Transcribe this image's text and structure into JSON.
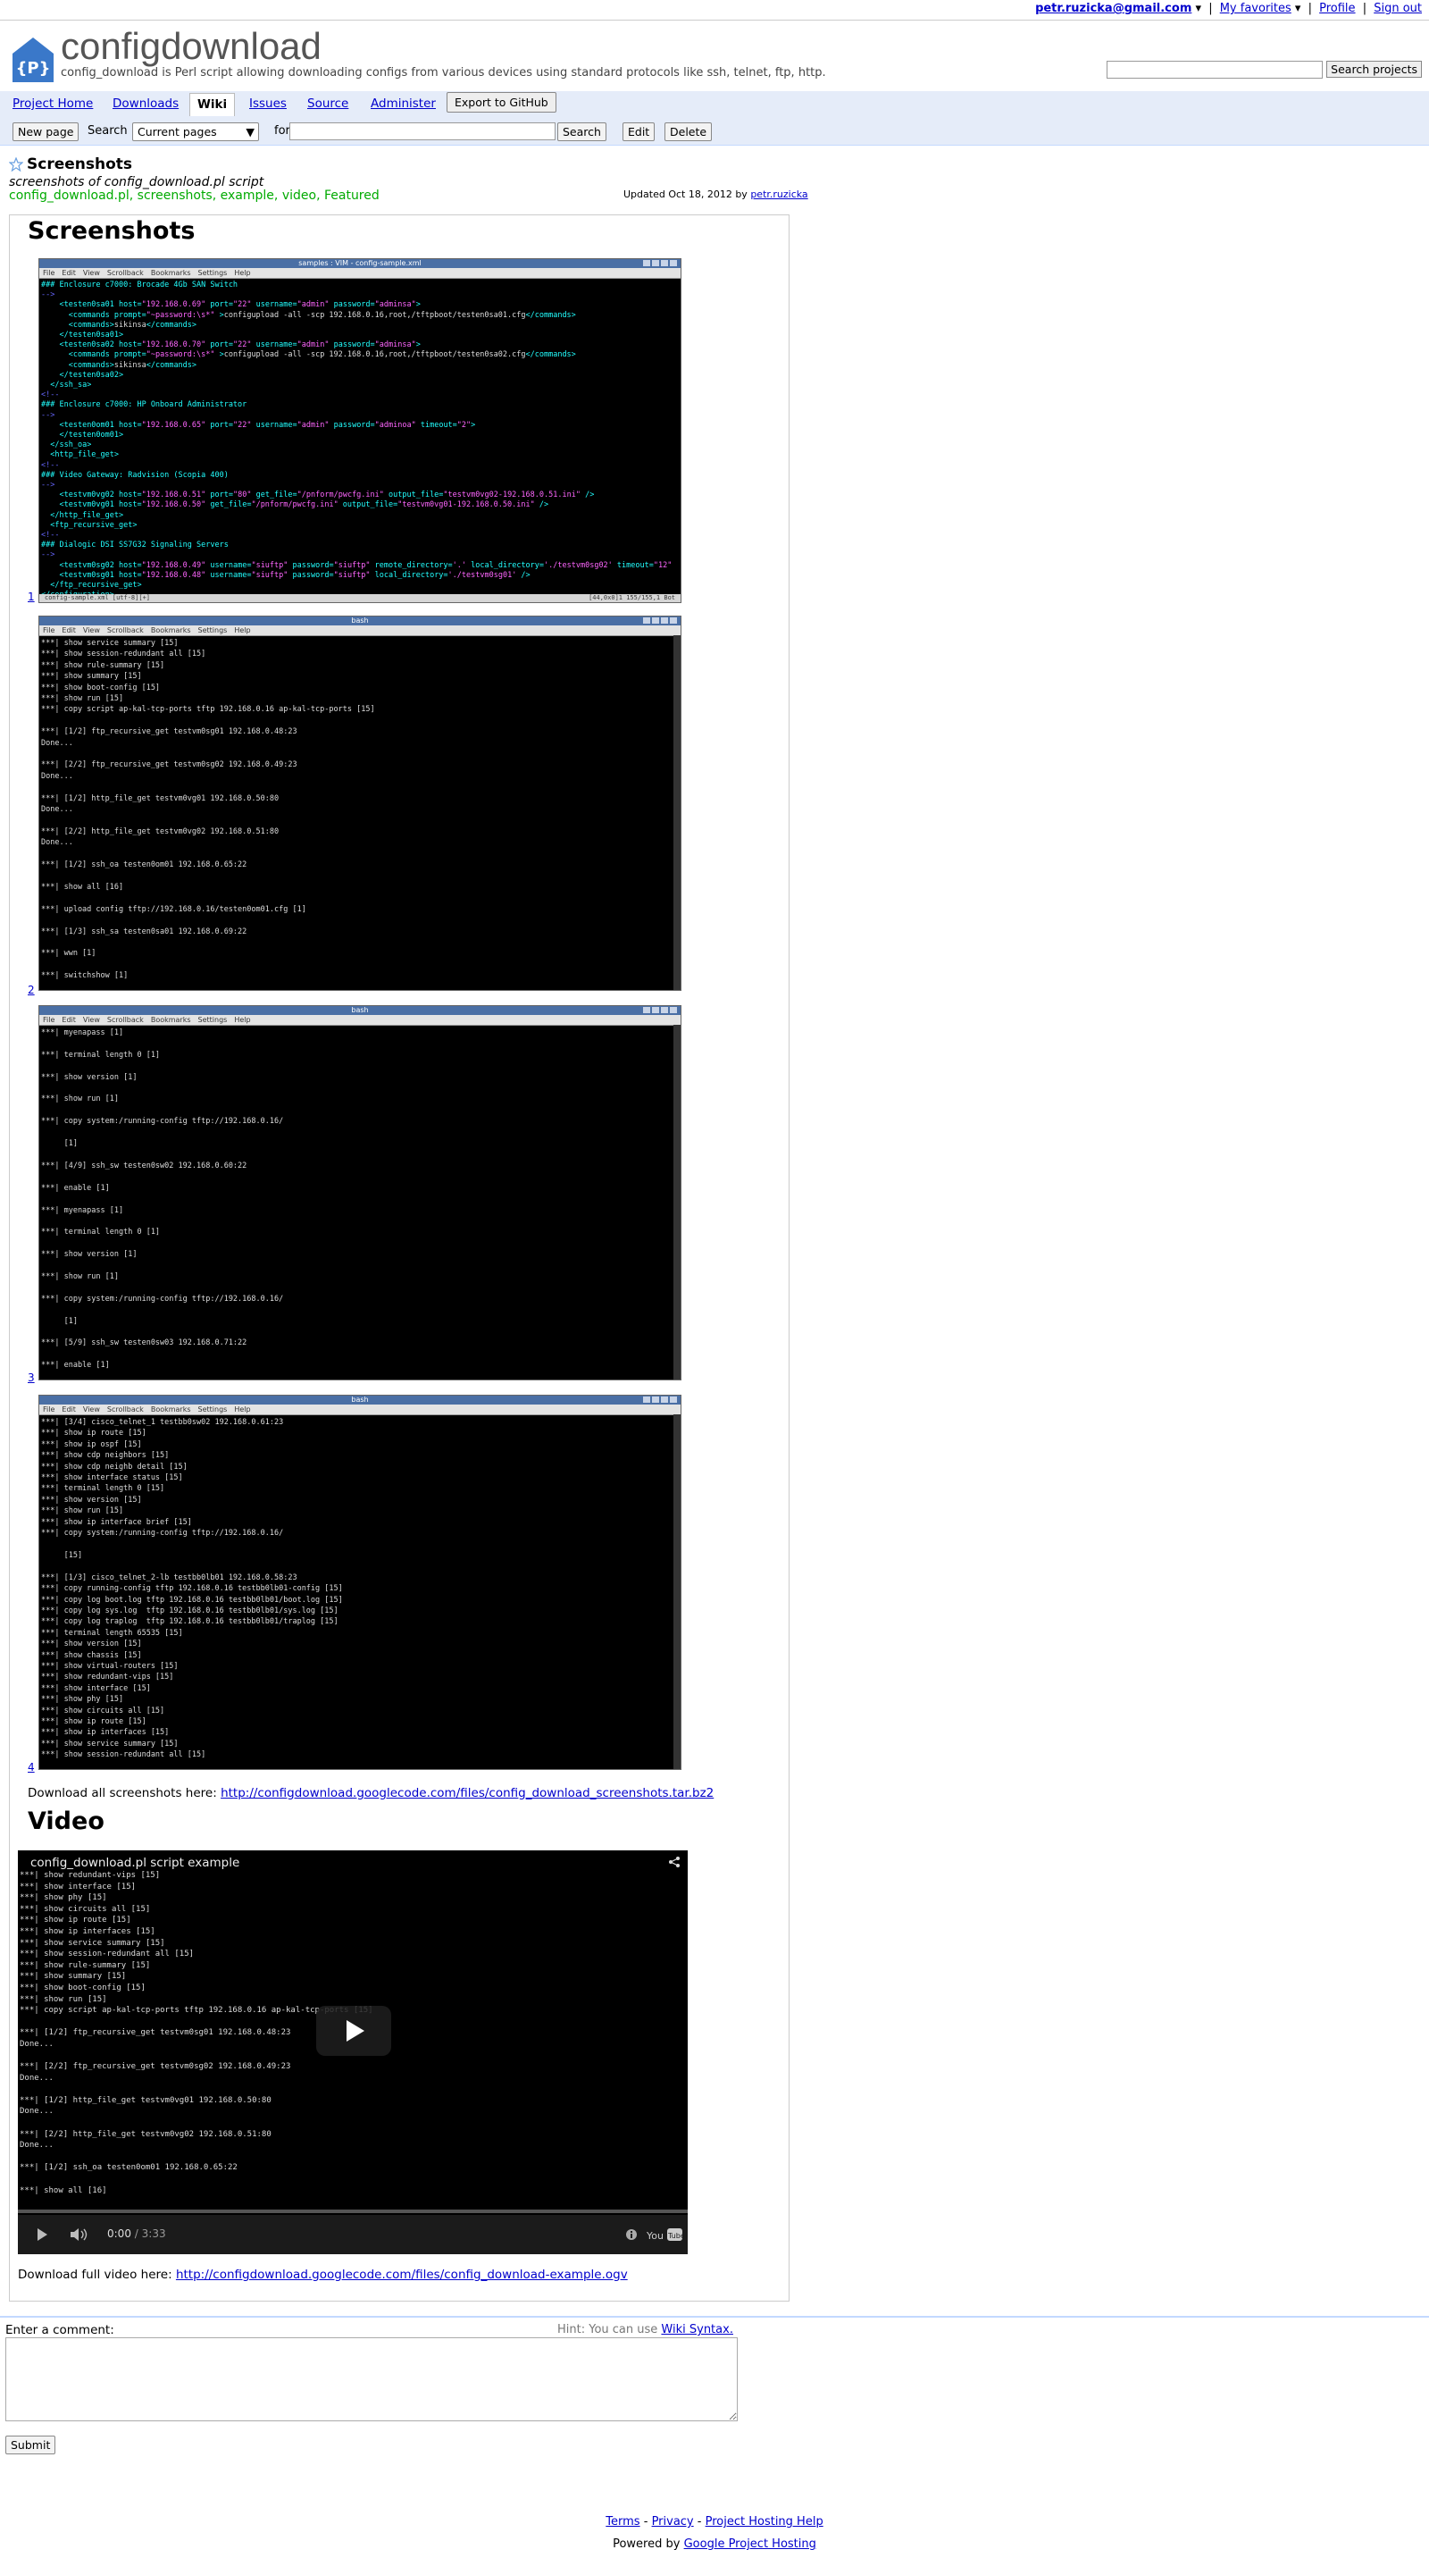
{
  "topbar": {
    "email": "petr.ruzicka@gmail.com",
    "favorites": "My favorites",
    "profile": "Profile",
    "signout": "Sign out"
  },
  "header": {
    "title": "configdownload",
    "summary": "config_download is Perl script allowing downloading configs from various devices using standard protocols like ssh, telnet, ftp, http.",
    "search_button": "Search projects"
  },
  "tabs": [
    "Project Home",
    "Downloads",
    "Wiki",
    "Issues",
    "Source",
    "Administer"
  ],
  "export_button": "Export to GitHub",
  "wiki_bar": {
    "new_page": "New page",
    "search_label": "Search",
    "scope": "Current pages",
    "for_label": "for",
    "search_button": "Search",
    "edit": "Edit",
    "delete": "Delete"
  },
  "wiki_page": {
    "name": "Screenshots",
    "summary": "screenshots of config_download.pl script",
    "labels": [
      "config_download.pl",
      "screenshots",
      "example",
      "video",
      "Featured"
    ],
    "updated_prefix": "Updated Oct 18, 2012 by",
    "updated_by": "petr.ruzicka"
  },
  "content": {
    "heading_screenshots": "Screenshots",
    "screenshots": [
      {
        "number": "1",
        "window_title": "samples : VIM - config-sample.xml"
      },
      {
        "number": "2",
        "window_title": "bash"
      },
      {
        "number": "3",
        "window_title": "bash"
      },
      {
        "number": "4",
        "window_title": "bash"
      }
    ],
    "terminal_menu": [
      "File",
      "Edit",
      "View",
      "Scrollback",
      "Bookmarks",
      "Settings",
      "Help"
    ],
    "vim_status": "config-sample.xml [utf-8][+]",
    "vim_position": "[44,0x0]1  155/155,1  Bot",
    "download_screens_prefix": "Download all screenshots here:",
    "download_screens_url": "http://configdownload.googlecode.com/files/config_download_screenshots.tar.bz2",
    "heading_video": "Video",
    "video": {
      "title": "config_download.pl script example",
      "current_time": "0:00",
      "duration": "/ 3:33"
    },
    "download_video_prefix": "Download full video here:",
    "download_video_url": "http://configdownload.googlecode.com/files/config_download-example.ogv"
  },
  "comment": {
    "label": "Enter a comment:",
    "hint_prefix": "Hint: You can use",
    "hint_link": "Wiki Syntax.",
    "submit": "Submit"
  },
  "footer": {
    "terms": "Terms",
    "privacy": "Privacy",
    "help": "Project Hosting Help",
    "powered_prefix": "Powered by",
    "powered_link": "Google Project Hosting"
  }
}
